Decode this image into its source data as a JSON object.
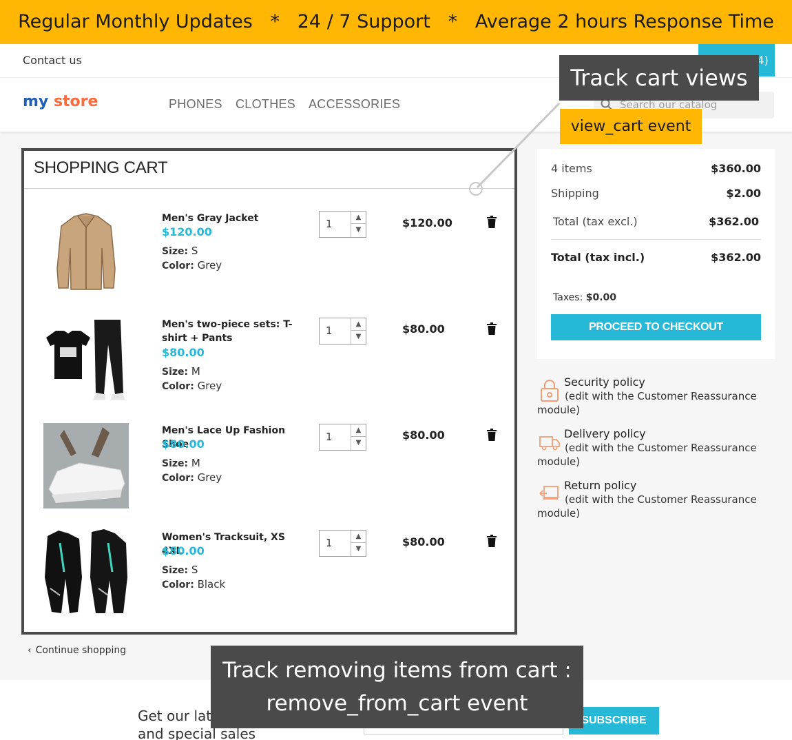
{
  "banner": {
    "text": "Regular Monthly Updates   *   24 / 7 Support   *   Average 2 hours Response Time"
  },
  "topbar": {
    "contact": "Contact us",
    "cart_count": "(4)"
  },
  "header": {
    "logo_my": "my",
    "logo_store": "store",
    "nav": [
      "PHONES",
      "CLOTHES",
      "ACCESSORIES"
    ],
    "search_placeholder": "Search our catalog"
  },
  "cart": {
    "title": "SHOPPING CART",
    "items": [
      {
        "name": "Men's Gray Jacket",
        "price": "$120.00",
        "size_label": "Size:",
        "size": "S",
        "color_label": "Color:",
        "color": "Grey",
        "qty": "1",
        "total": "$120.00"
      },
      {
        "name": "Men's two-piece sets: T-shirt + Pants",
        "price": "$80.00",
        "size_label": "Size:",
        "size": "M",
        "color_label": "Color:",
        "color": "Grey",
        "qty": "1",
        "total": "$80.00"
      },
      {
        "name": "Men's Lace Up Fashion Shoe",
        "price": "$80.00",
        "size_label": "Size:",
        "size": "M",
        "color_label": "Color:",
        "color": "Grey",
        "qty": "1",
        "total": "$80.00"
      },
      {
        "name": "Women's Tracksuit, XS 4XL",
        "price": "$80.00",
        "size_label": "Size:",
        "size": "S",
        "color_label": "Color:",
        "color": "Black",
        "qty": "1",
        "total": "$80.00"
      }
    ],
    "continue": "Continue shopping"
  },
  "summary": {
    "items_label": "4 items",
    "items_value": "$360.00",
    "shipping_label": "Shipping",
    "shipping_value": "$2.00",
    "excl_label": "Total (tax excl.)",
    "excl_value": "$362.00",
    "incl_label": "Total (tax incl.)",
    "incl_value": "$362.00",
    "taxes_label": "Taxes:",
    "taxes_value": "$0.00",
    "checkout": "PROCEED TO CHECKOUT"
  },
  "reassurance": [
    {
      "title": "Security policy",
      "desc": "(edit with the Customer Reassurance module)"
    },
    {
      "title": "Delivery policy",
      "desc": "(edit with the Customer Reassurance module)"
    },
    {
      "title": "Return policy",
      "desc": "(edit with the Customer Reassurance module)"
    }
  ],
  "footer": {
    "newsletter": "Get our latest news and special sales",
    "subscribe": "SUBSCRIBE"
  },
  "annotations": {
    "track_views": "Track cart views",
    "view_event": "view_cart event",
    "track_remove_1": "Track removing items from cart :",
    "track_remove_2": "remove_from_cart event"
  },
  "colors": {
    "accent": "#25b9d7",
    "banner": "#ffb703",
    "callout": "#4a4a4a"
  }
}
